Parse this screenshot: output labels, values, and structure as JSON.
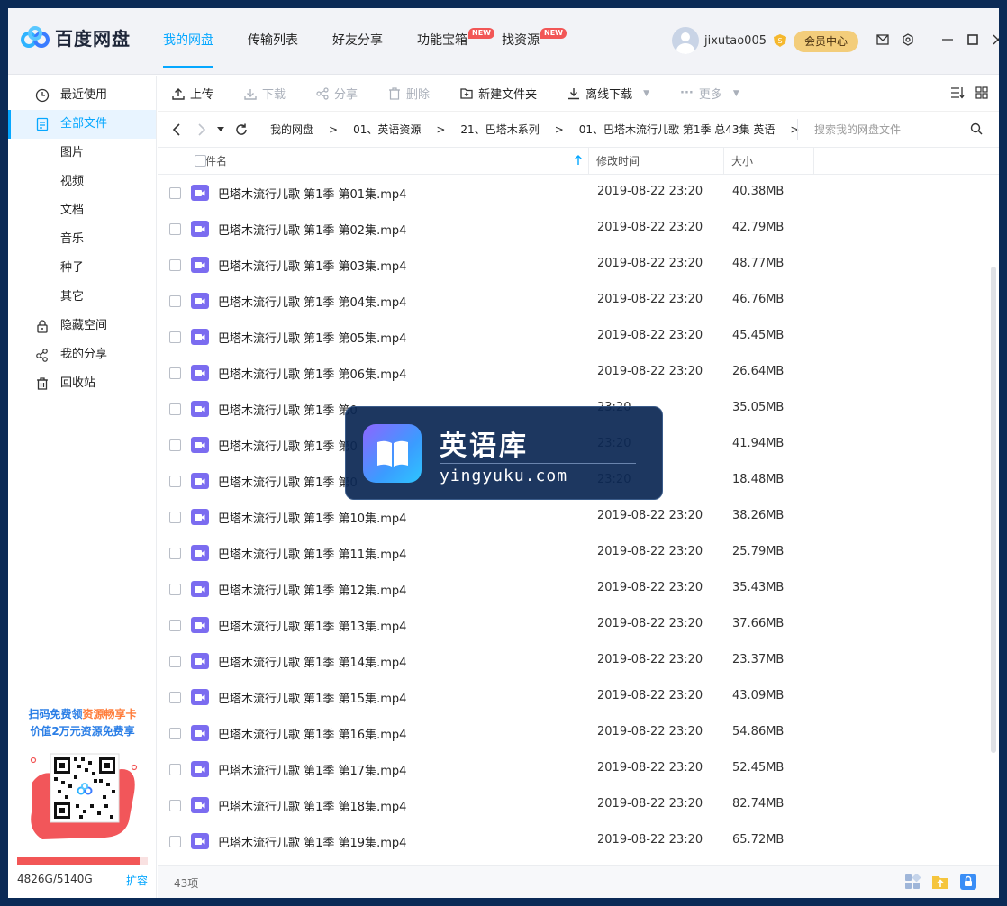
{
  "app": {
    "name": "百度网盘"
  },
  "nav": {
    "items": [
      {
        "label": "我的网盘"
      },
      {
        "label": "传输列表"
      },
      {
        "label": "好友分享"
      },
      {
        "label": "功能宝箱",
        "badge": "NEW"
      },
      {
        "label": "找资源",
        "badge": "NEW"
      }
    ]
  },
  "user": {
    "name": "jixutao005",
    "member_button": "会员中心"
  },
  "sidebar": {
    "items": [
      {
        "label": "最近使用",
        "icon": "clock-icon"
      },
      {
        "label": "全部文件",
        "icon": "file-icon"
      },
      {
        "label": "图片"
      },
      {
        "label": "视频"
      },
      {
        "label": "文档"
      },
      {
        "label": "音乐"
      },
      {
        "label": "种子"
      },
      {
        "label": "其它"
      },
      {
        "label": "隐藏空间",
        "icon": "lock-icon"
      },
      {
        "label": "我的分享",
        "icon": "share-icon"
      },
      {
        "label": "回收站",
        "icon": "trash-icon"
      }
    ],
    "promo": {
      "line1_a": "扫码免费领",
      "line1_b": "资源畅享卡",
      "line2": "价值2万元资源免费享"
    },
    "storage": {
      "text": "4826G/5140G",
      "expand": "扩容",
      "used_fraction": 0.939
    }
  },
  "toolbar": {
    "upload": "上传",
    "download": "下载",
    "share": "分享",
    "delete": "删除",
    "new_folder": "新建文件夹",
    "offline": "离线下载",
    "more": "更多"
  },
  "breadcrumb": [
    "我的网盘",
    "01、英语资源",
    "21、巴塔木系列",
    "01、巴塔木流行儿歌 第1季 总43集 英语"
  ],
  "search": {
    "placeholder": "搜索我的网盘文件"
  },
  "columns": {
    "name": "文件名",
    "date": "修改时间",
    "size": "大小"
  },
  "files": [
    {
      "name": "巴塔木流行儿歌 第1季 第01集.mp4",
      "date": "2019-08-22 23:20",
      "size": "40.38MB"
    },
    {
      "name": "巴塔木流行儿歌 第1季 第02集.mp4",
      "date": "2019-08-22 23:20",
      "size": "42.79MB"
    },
    {
      "name": "巴塔木流行儿歌 第1季 第03集.mp4",
      "date": "2019-08-22 23:20",
      "size": "48.77MB"
    },
    {
      "name": "巴塔木流行儿歌 第1季 第04集.mp4",
      "date": "2019-08-22 23:20",
      "size": "46.76MB"
    },
    {
      "name": "巴塔木流行儿歌 第1季 第05集.mp4",
      "date": "2019-08-22 23:20",
      "size": "45.45MB"
    },
    {
      "name": "巴塔木流行儿歌 第1季 第06集.mp4",
      "date": "2019-08-22 23:20",
      "size": "26.64MB"
    },
    {
      "name": "巴塔木流行儿歌 第1季 第0",
      "date": "23:20",
      "size": "35.05MB"
    },
    {
      "name": "巴塔木流行儿歌 第1季 第0",
      "date": "23:20",
      "size": "41.94MB"
    },
    {
      "name": "巴塔木流行儿歌 第1季 第0",
      "date": "23:20",
      "size": "18.48MB"
    },
    {
      "name": "巴塔木流行儿歌 第1季 第10集.mp4",
      "date": "2019-08-22 23:20",
      "size": "38.26MB"
    },
    {
      "name": "巴塔木流行儿歌 第1季 第11集.mp4",
      "date": "2019-08-22 23:20",
      "size": "25.79MB"
    },
    {
      "name": "巴塔木流行儿歌 第1季 第12集.mp4",
      "date": "2019-08-22 23:20",
      "size": "35.43MB"
    },
    {
      "name": "巴塔木流行儿歌 第1季 第13集.mp4",
      "date": "2019-08-22 23:20",
      "size": "37.66MB"
    },
    {
      "name": "巴塔木流行儿歌 第1季 第14集.mp4",
      "date": "2019-08-22 23:20",
      "size": "23.37MB"
    },
    {
      "name": "巴塔木流行儿歌 第1季 第15集.mp4",
      "date": "2019-08-22 23:20",
      "size": "43.09MB"
    },
    {
      "name": "巴塔木流行儿歌 第1季 第16集.mp4",
      "date": "2019-08-22 23:20",
      "size": "54.86MB"
    },
    {
      "name": "巴塔木流行儿歌 第1季 第17集.mp4",
      "date": "2019-08-22 23:20",
      "size": "52.45MB"
    },
    {
      "name": "巴塔木流行儿歌 第1季 第18集.mp4",
      "date": "2019-08-22 23:20",
      "size": "82.74MB"
    },
    {
      "name": "巴塔木流行儿歌 第1季 第19集.mp4",
      "date": "2019-08-22 23:20",
      "size": "65.72MB"
    }
  ],
  "status": {
    "count": "43项"
  },
  "watermark": {
    "title": "英语库",
    "url": "yingyuku.com"
  },
  "colors": {
    "accent": "#06a7ff",
    "badge": "#f25656",
    "member": "#f3cd7b",
    "video_icon": "#7b6cf0"
  }
}
